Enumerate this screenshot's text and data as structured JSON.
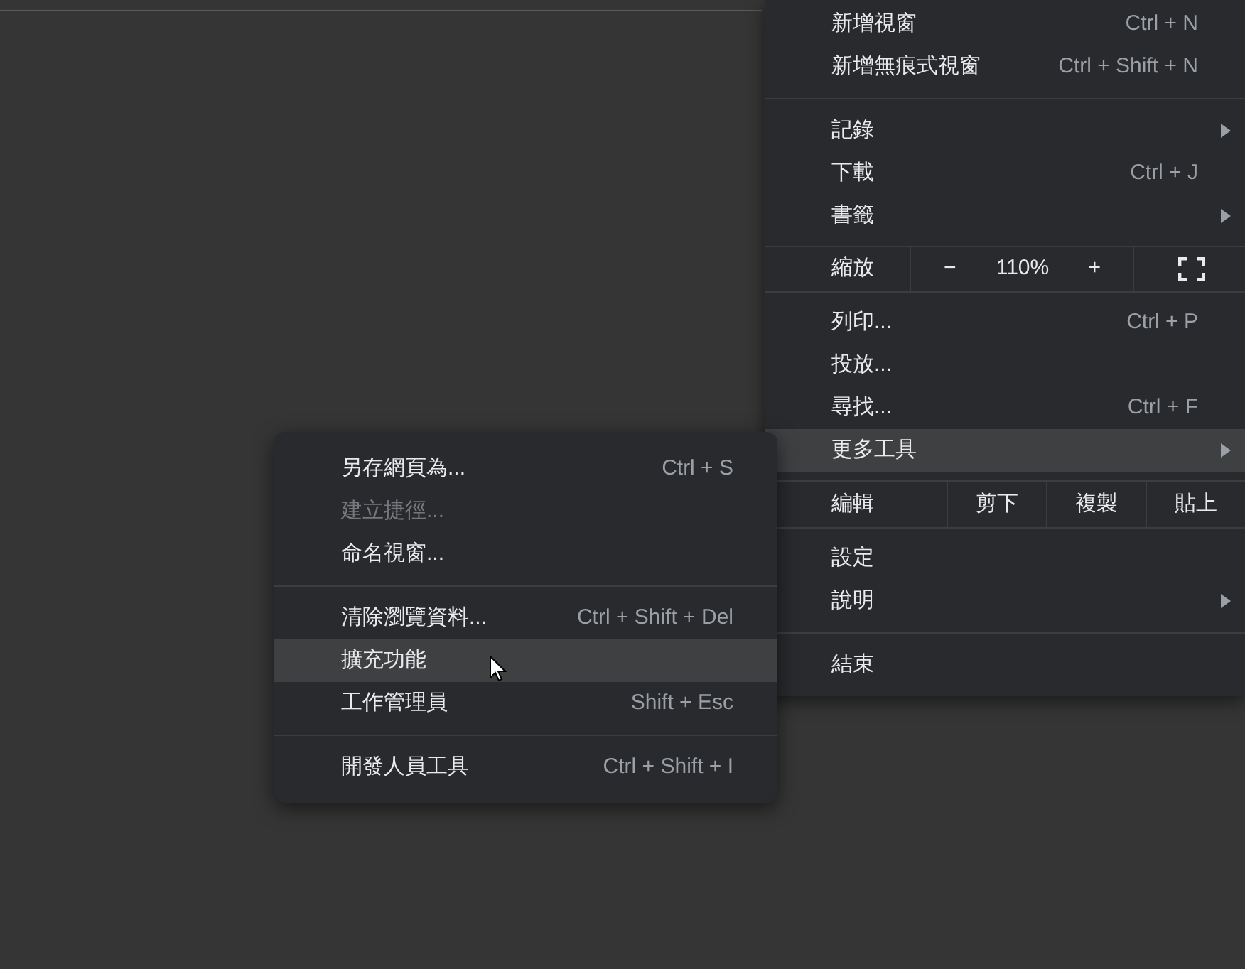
{
  "main_menu": {
    "items": [
      {
        "kind": "item",
        "label": "新增視窗",
        "shortcut": "Ctrl + N"
      },
      {
        "kind": "item",
        "label": "新增無痕式視窗",
        "shortcut": "Ctrl + Shift + N"
      },
      {
        "kind": "divider"
      },
      {
        "kind": "item",
        "label": "記錄",
        "submenu": true
      },
      {
        "kind": "item",
        "label": "下載",
        "shortcut": "Ctrl + J"
      },
      {
        "kind": "item",
        "label": "書籤",
        "submenu": true
      },
      {
        "kind": "zoom",
        "label": "縮放",
        "minus": "−",
        "value": "110%",
        "plus": "+"
      },
      {
        "kind": "item",
        "label": "列印...",
        "shortcut": "Ctrl + P"
      },
      {
        "kind": "item",
        "label": "投放..."
      },
      {
        "kind": "item",
        "label": "尋找...",
        "shortcut": "Ctrl + F"
      },
      {
        "kind": "item",
        "label": "更多工具",
        "submenu": true,
        "highlighted": true
      },
      {
        "kind": "edit",
        "label": "編輯",
        "actions": [
          "剪下",
          "複製",
          "貼上"
        ]
      },
      {
        "kind": "item",
        "label": "設定"
      },
      {
        "kind": "item",
        "label": "說明",
        "submenu": true
      },
      {
        "kind": "divider"
      },
      {
        "kind": "item",
        "label": "結束"
      }
    ]
  },
  "submenu": {
    "items": [
      {
        "kind": "item",
        "label": "另存網頁為...",
        "shortcut": "Ctrl + S",
        "disabled": false,
        "highlighted": false
      },
      {
        "kind": "item",
        "label": "建立捷徑...",
        "disabled": true,
        "highlighted": false
      },
      {
        "kind": "item",
        "label": "命名視窗...",
        "disabled": false,
        "highlighted": false
      },
      {
        "kind": "divider"
      },
      {
        "kind": "item",
        "label": "清除瀏覽資料...",
        "shortcut": "Ctrl + Shift + Del",
        "disabled": false,
        "highlighted": false
      },
      {
        "kind": "item",
        "label": "擴充功能",
        "disabled": false,
        "highlighted": true
      },
      {
        "kind": "item",
        "label": "工作管理員",
        "shortcut": "Shift + Esc",
        "disabled": false,
        "highlighted": false
      },
      {
        "kind": "divider"
      },
      {
        "kind": "item",
        "label": "開發人員工具",
        "shortcut": "Ctrl + Shift + I",
        "disabled": false,
        "highlighted": false
      }
    ]
  }
}
